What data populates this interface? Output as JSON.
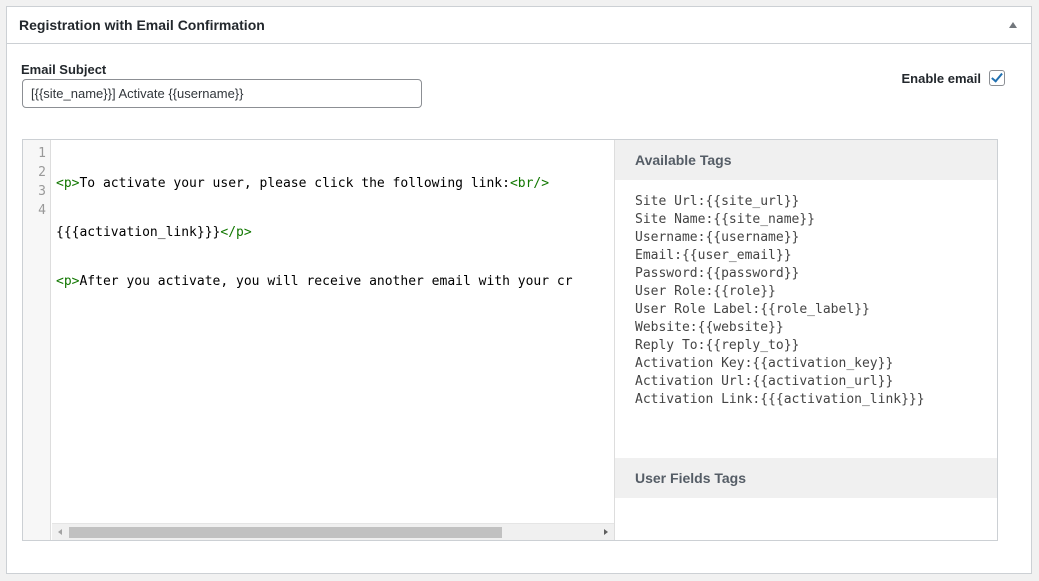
{
  "postbox": {
    "title": "Registration with Email Confirmation"
  },
  "subject": {
    "label": "Email Subject",
    "value": "[{{site_name}}] Activate {{username}}"
  },
  "enable": {
    "label": "Enable email",
    "checked": true
  },
  "editor": {
    "line_numbers": [
      "1",
      "2",
      "3",
      "4"
    ],
    "line1_tag_open": "<p>",
    "line1_text": "To activate your user, please click the following link:",
    "line1_tag_br": "<br/>",
    "line2_text": "{{{activation_link}}}",
    "line2_tag_close": "</p>",
    "line3_tag_open": "<p>",
    "line3_text": "After you activate, you will receive another email with your cr"
  },
  "available_tags": {
    "title": "Available Tags",
    "items": [
      "Site Url:{{site_url}}",
      "Site Name:{{site_name}}",
      "Username:{{username}}",
      "Email:{{user_email}}",
      "Password:{{password}}",
      "User Role:{{role}}",
      "User Role Label:{{role_label}}",
      "Website:{{website}}",
      "Reply To:{{reply_to}}",
      "Activation Key:{{activation_key}}",
      "Activation Url:{{activation_url}}",
      "Activation Link:{{{activation_link}}}"
    ]
  },
  "user_fields_tags": {
    "title": "User Fields Tags"
  }
}
